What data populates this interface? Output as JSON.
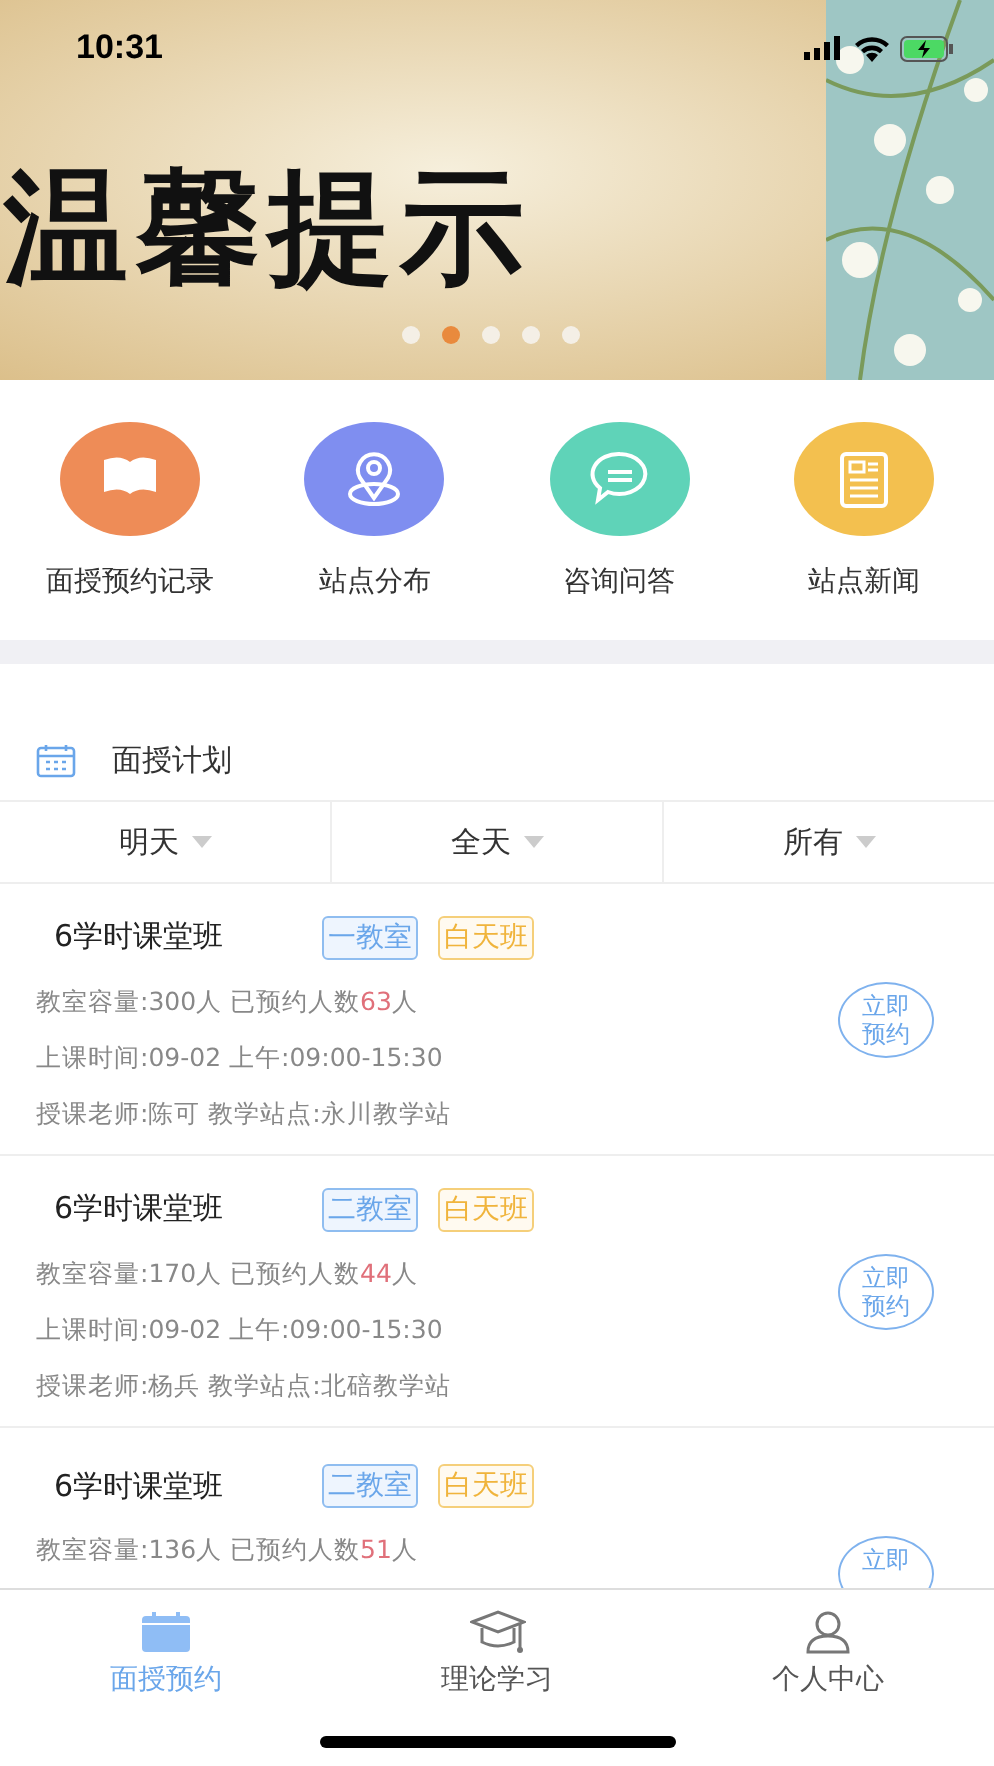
{
  "status_bar": {
    "time": "10:31"
  },
  "banner": {
    "title": "温馨提示",
    "dots": [
      {
        "selected": false
      },
      {
        "selected": true
      },
      {
        "selected": false
      },
      {
        "selected": false
      },
      {
        "selected": false
      }
    ]
  },
  "shortcuts": [
    {
      "label": "面授预约记录",
      "kind": "book",
      "color": "#ee8c57"
    },
    {
      "label": "站点分布",
      "kind": "location",
      "color": "#7f8ef0"
    },
    {
      "label": "咨询问答",
      "kind": "chat",
      "color": "#5fd3b8"
    },
    {
      "label": "站点新闻",
      "kind": "news",
      "color": "#f3c04f"
    }
  ],
  "section": {
    "title": "面授计划"
  },
  "filters": [
    {
      "label": "明天"
    },
    {
      "label": "全天"
    },
    {
      "label": "所有"
    }
  ],
  "classes": [
    {
      "title": "6学时课堂班",
      "room": "一教室",
      "shift": "白天班",
      "capacity": "教室容量:300人  已预约人数",
      "booked": "63",
      "booked_unit": "人",
      "time": "上课时间:09-02  上午:09:00-15:30",
      "teacher": "授课老师:陈可  教学站点:永川教学站",
      "button": "立即预约"
    },
    {
      "title": "6学时课堂班",
      "room": "二教室",
      "shift": "白天班",
      "capacity": "教室容量:170人  已预约人数",
      "booked": "44",
      "booked_unit": "人",
      "time": "上课时间:09-02  上午:09:00-15:30",
      "teacher": "授课老师:杨兵  教学站点:北碚教学站",
      "button": "立即预约"
    },
    {
      "title": "6学时课堂班",
      "room": "二教室",
      "shift": "白天班",
      "capacity": "教室容量:136人  已预约人数",
      "booked": "51",
      "booked_unit": "人",
      "button": "立即"
    }
  ],
  "tab_bar": [
    {
      "label": "面授预约",
      "kind": "calendar",
      "selected": true
    },
    {
      "label": "理论学习",
      "kind": "cap",
      "selected": false
    },
    {
      "label": "个人中心",
      "kind": "person",
      "selected": false
    }
  ]
}
